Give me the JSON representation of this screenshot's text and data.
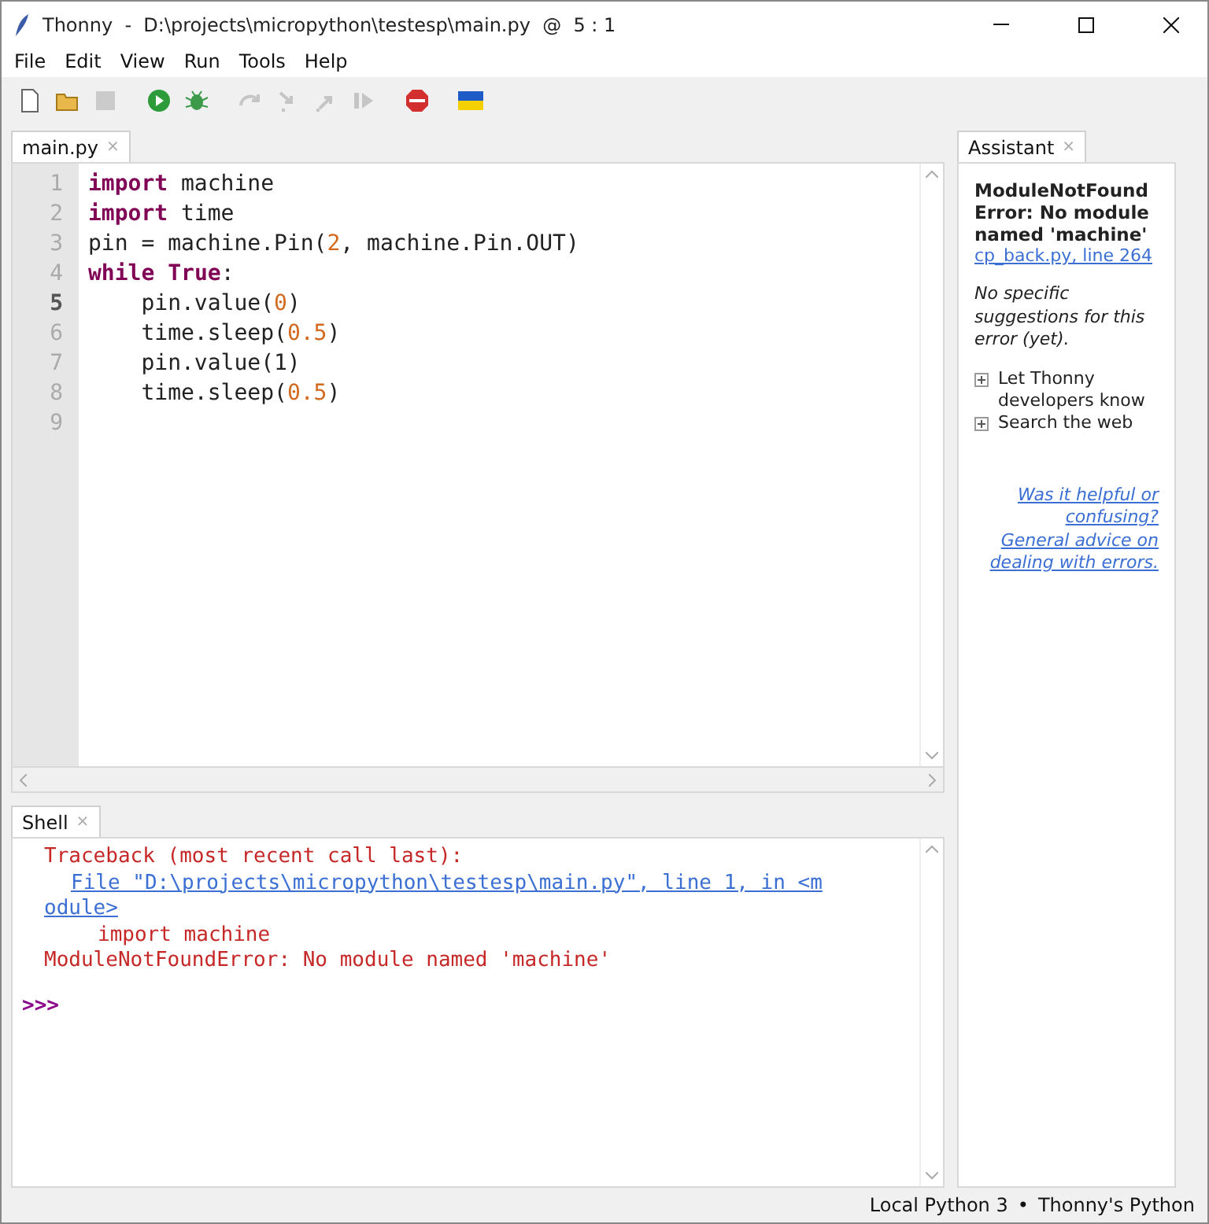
{
  "window": {
    "title": "Thonny  -  D:\\projects\\micropython\\testesp\\main.py  @  5 : 1"
  },
  "menu": [
    "File",
    "Edit",
    "View",
    "Run",
    "Tools",
    "Help"
  ],
  "toolbar": [
    {
      "kind": "new",
      "disabled": false
    },
    {
      "kind": "open",
      "disabled": false
    },
    {
      "kind": "save",
      "disabled": true
    },
    {
      "kind": "run",
      "disabled": false
    },
    {
      "kind": "debug",
      "disabled": false
    },
    {
      "kind": "step-over",
      "disabled": true
    },
    {
      "kind": "step-into",
      "disabled": true
    },
    {
      "kind": "step-out",
      "disabled": true
    },
    {
      "kind": "resume",
      "disabled": true
    },
    {
      "kind": "stop",
      "disabled": false
    },
    {
      "kind": "flag",
      "disabled": false
    }
  ],
  "editor": {
    "tabs": [
      {
        "label": "main.py",
        "close": "×",
        "selected": true
      }
    ],
    "lines": [
      {
        "number": "1",
        "current": false,
        "tokens": [
          {
            "kind": "keyword",
            "text": "import"
          },
          {
            "kind": "plain",
            "text": " machine"
          }
        ]
      },
      {
        "number": "2",
        "current": false,
        "tokens": [
          {
            "kind": "keyword",
            "text": "import"
          },
          {
            "kind": "plain",
            "text": " time"
          }
        ]
      },
      {
        "number": "3",
        "current": false,
        "tokens": [
          {
            "kind": "plain",
            "text": "pin = machine.Pin("
          },
          {
            "kind": "number",
            "text": "2"
          },
          {
            "kind": "plain",
            "text": ", machine.Pin.OUT)"
          }
        ]
      },
      {
        "number": "4",
        "current": false,
        "tokens": [
          {
            "kind": "keyword",
            "text": "while"
          },
          {
            "kind": "keyword",
            "text": " True"
          },
          {
            "kind": "plain",
            "text": ":"
          }
        ]
      },
      {
        "number": "5",
        "current": true,
        "tokens": [
          {
            "kind": "plain",
            "text": "    pin.value("
          },
          {
            "kind": "number",
            "text": "0"
          },
          {
            "kind": "plain",
            "text": ")"
          }
        ]
      },
      {
        "number": "6",
        "current": false,
        "tokens": [
          {
            "kind": "plain",
            "text": "    time.sleep("
          },
          {
            "kind": "number",
            "text": "0.5"
          },
          {
            "kind": "plain",
            "text": ")"
          }
        ]
      },
      {
        "number": "7",
        "current": false,
        "tokens": [
          {
            "kind": "plain",
            "text": "    pin.value(1)"
          }
        ]
      },
      {
        "number": "8",
        "current": false,
        "tokens": [
          {
            "kind": "plain",
            "text": "    time.sleep("
          },
          {
            "kind": "number",
            "text": "0.5"
          },
          {
            "kind": "plain",
            "text": ")"
          }
        ]
      },
      {
        "number": "9",
        "current": false
      }
    ]
  },
  "shell": {
    "tabs": [
      {
        "label": "Shell",
        "close": "×",
        "selected": true
      }
    ],
    "lines": [
      {
        "kind": "error",
        "text": "Traceback (most recent call last):"
      },
      {
        "kind": "link",
        "text": "File \"D:\\projects\\micropython\\testesp\\main.py\", line 1, in <module>"
      },
      {
        "kind": "code",
        "text": "import machine"
      },
      {
        "kind": "error",
        "text": "ModuleNotFoundError: No module named 'machine'"
      },
      {
        "kind": "prompt",
        "text": ">>>"
      }
    ]
  },
  "assistant": {
    "tabs": [
      {
        "label": "Assistant",
        "close": "×",
        "selected": true
      }
    ],
    "error_title": "ModuleNotFoundError: No module named 'machine'",
    "source_link": "cp_back.py, line 264",
    "note": "No specific suggestions for this error (yet).",
    "sections": [
      {
        "label": "Let Thonny developers know",
        "expanded": false
      },
      {
        "label": "Search the web",
        "expanded": false
      }
    ],
    "feedback_links": [
      "Was it helpful or confusing?",
      "General advice on dealing with errors."
    ]
  },
  "status_bar": {
    "items": [
      "Local Python 3",
      "•",
      "Thonny's Python"
    ]
  }
}
